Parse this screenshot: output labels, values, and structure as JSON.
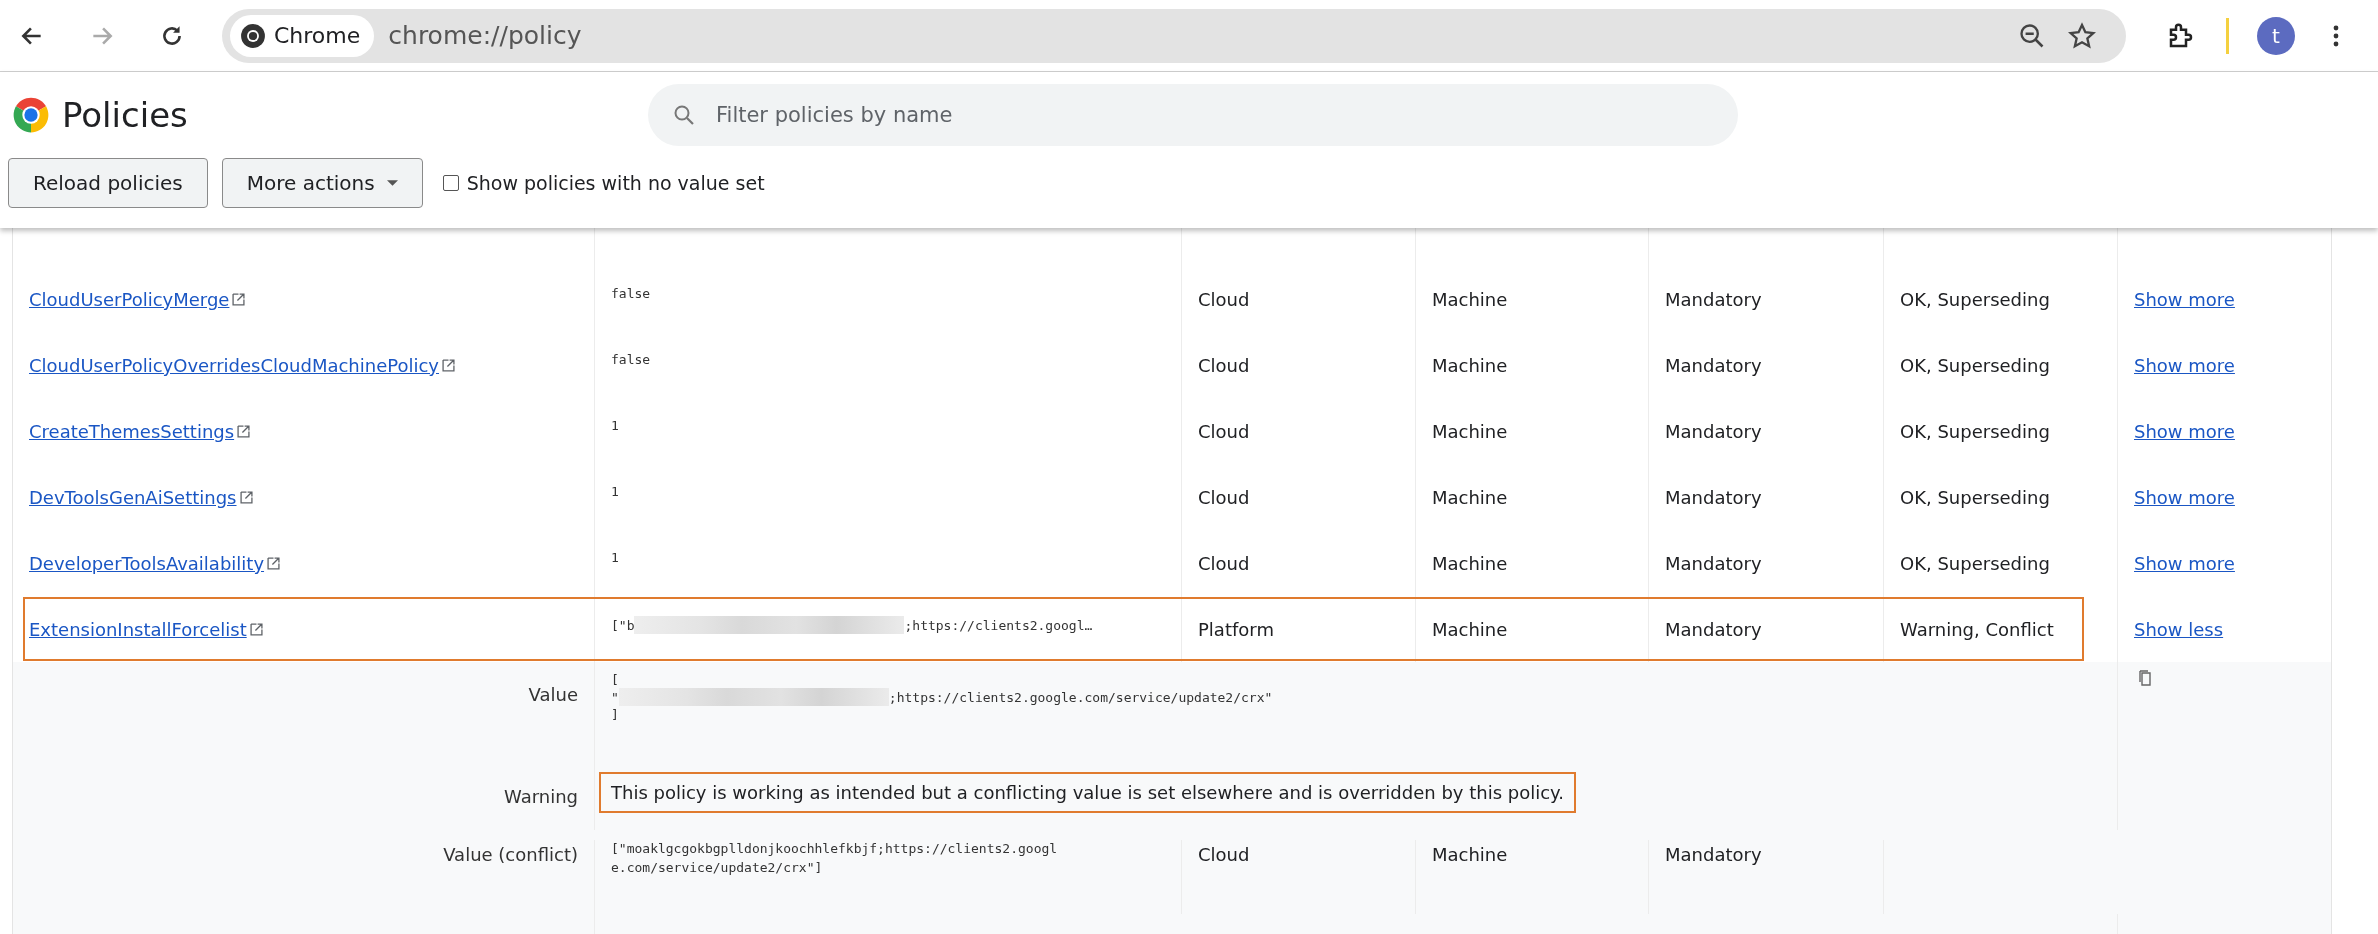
{
  "browser": {
    "chip_label": "Chrome",
    "url": "chrome://policy",
    "avatar_letter": "t"
  },
  "page": {
    "title": "Policies",
    "search": {
      "placeholder": "Filter policies by name"
    },
    "buttons": [
      {
        "label": "Reload policies",
        "kind": "plain"
      },
      {
        "label": "More actions",
        "kind": "dropdown"
      }
    ],
    "show_unset": {
      "label": "Show policies with no value set",
      "checked": false
    }
  },
  "policies": [
    {
      "name": "CloudUserPolicyMerge",
      "value": [
        "false"
      ],
      "source": "Cloud",
      "scope": "Machine",
      "level": "Mandatory",
      "status": "OK, Superseding",
      "toggle": "Show more",
      "expanded": false,
      "highlighted": false
    },
    {
      "name": "CloudUserPolicyOverridesCloudMachinePolicy",
      "value": [
        "false"
      ],
      "source": "Cloud",
      "scope": "Machine",
      "level": "Mandatory",
      "status": "OK, Superseding",
      "toggle": "Show more",
      "expanded": false,
      "highlighted": false
    },
    {
      "name": "CreateThemesSettings",
      "value": [
        "1"
      ],
      "source": "Cloud",
      "scope": "Machine",
      "level": "Mandatory",
      "status": "OK, Superseding",
      "toggle": "Show more",
      "expanded": false,
      "highlighted": false
    },
    {
      "name": "DevToolsGenAiSettings",
      "value": [
        "1"
      ],
      "source": "Cloud",
      "scope": "Machine",
      "level": "Mandatory",
      "status": "OK, Superseding",
      "toggle": "Show more",
      "expanded": false,
      "highlighted": false
    },
    {
      "name": "DeveloperToolsAvailability",
      "value": [
        "1"
      ],
      "source": "Cloud",
      "scope": "Machine",
      "level": "Mandatory",
      "status": "OK, Superseding",
      "toggle": "Show more",
      "expanded": false,
      "highlighted": false
    },
    {
      "name": "ExtensionInstallForcelist",
      "value": [
        "[\"b",
        ";https://clients2.googl…"
      ],
      "source": "Platform",
      "scope": "Machine",
      "level": "Mandatory",
      "status": "Warning, Conflict",
      "toggle": "Show less",
      "expanded": true,
      "highlighted": true,
      "details": [
        {
          "label": "Value",
          "kind": "value_block",
          "lines": [
            [
              "["
            ],
            [
              "\"",
              ";https://clients2.google.com/service/update2/crx\""
            ],
            [
              "]"
            ]
          ]
        },
        {
          "label": "Warning",
          "kind": "message",
          "text": "This policy is working as intended but a conflicting value is set elsewhere and is overridden by this policy.",
          "highlighted": true
        },
        {
          "label": "Value (conflict)",
          "kind": "conflict",
          "value": "[\"moaklgcgokbgplldonjkoochhlefkbjf;https://clients2.google.com/service/update2/crx\"]",
          "source": "Cloud",
          "scope": "Machine",
          "level": "Mandatory"
        }
      ]
    }
  ]
}
